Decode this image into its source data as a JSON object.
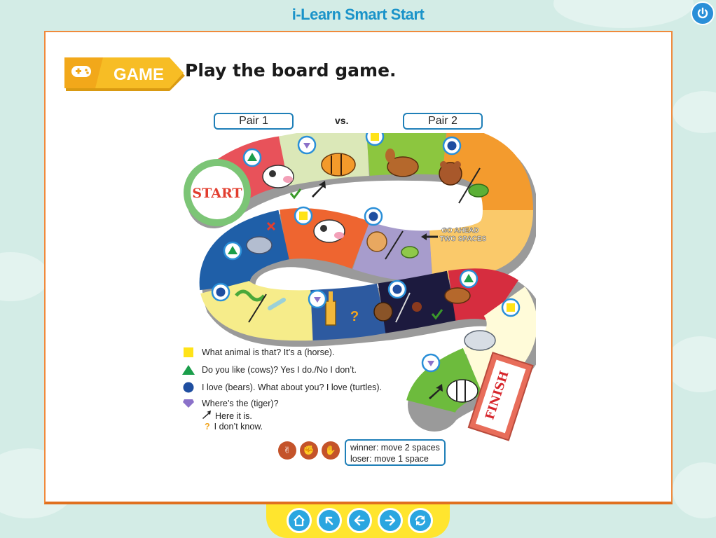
{
  "app": {
    "title": "i-Learn Smart Start"
  },
  "activity": {
    "badge_label": "GAME",
    "instruction": "Play the board game.",
    "pair_left": "Pair 1",
    "versus": "vs.",
    "pair_right": "Pair 2"
  },
  "board": {
    "start_label": "START",
    "finish_label": "FINISH",
    "go_ahead_line1": "GO AHEAD",
    "go_ahead_line2": "TWO SPACES",
    "question_mark": "?"
  },
  "legend": {
    "square": "What animal is that? It’s a (horse).",
    "triangle": "Do you like (cows)? Yes I do./No I don’t.",
    "circle": "I love (bears). What about you? I love (turtles).",
    "diamond": "Where’s the (tiger)?",
    "arrow": "Here it is.",
    "question": "I don’t know."
  },
  "rules": {
    "winner": "winner: move 2 spaces",
    "loser": "loser: move 1 space"
  },
  "colors": {
    "accent_blue": "#1f7fb8",
    "frame_orange": "#f08a3c",
    "nav_yellow": "#ffe52e",
    "nav_button": "#2aa6e0"
  },
  "icons": [
    "power-icon",
    "home-icon",
    "back-to-top-icon",
    "previous-icon",
    "next-icon",
    "refresh-icon"
  ]
}
